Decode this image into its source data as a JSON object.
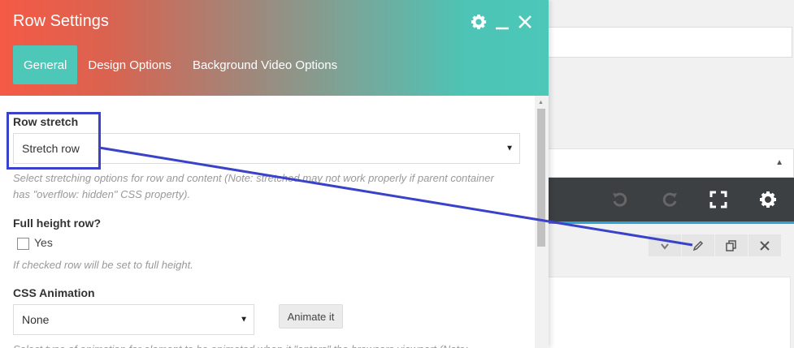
{
  "modal": {
    "title": "Row Settings",
    "tabs": [
      {
        "label": "General",
        "active": true
      },
      {
        "label": "Design Options",
        "active": false
      },
      {
        "label": "Background Video Options",
        "active": false
      }
    ]
  },
  "fields": {
    "row_stretch": {
      "label": "Row stretch",
      "value": "Stretch row",
      "help": "Select stretching options for row and content (Note: stretched may not work properly if parent container has \"overflow: hidden\" CSS property)."
    },
    "full_height": {
      "label": "Full height row?",
      "checkbox_label": "Yes",
      "checked": false,
      "help": "If checked row will be set to full height."
    },
    "css_animation": {
      "label": "CSS Animation",
      "value": "None",
      "button_label": "Animate it",
      "help": "Select type of animation for element to be animated when it \"enters\" the browsers viewport (Note:"
    }
  },
  "icons": {
    "header": [
      "gear-icon",
      "minimize-icon",
      "close-icon"
    ],
    "toolbar": [
      "undo-icon",
      "redo-icon",
      "fullscreen-icon",
      "settings-icon"
    ],
    "row_controls": [
      "move-icon",
      "pencil-icon",
      "copy-icon",
      "close-icon"
    ]
  },
  "colors": {
    "header_gradient_start": "#f55a45",
    "header_gradient_end": "#4cc7b8",
    "active_tab": "#4cc7b8",
    "toolbar_bg": "#3c4043",
    "toolbar_accent": "#2fa4d0",
    "annotation": "#3a42c9"
  }
}
